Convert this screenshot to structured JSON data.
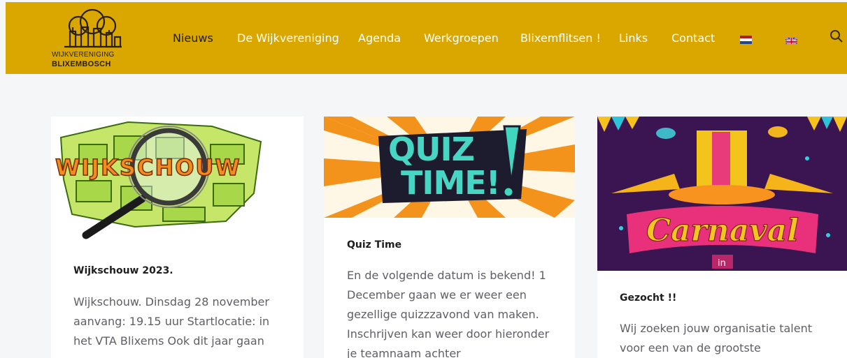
{
  "header": {
    "logo_line1": "WIJKVERENIGING",
    "logo_line2": "BLIXEMBOSCH",
    "bg_color": "#d9a700",
    "nav": [
      {
        "label": "Nieuws",
        "active": true
      },
      {
        "label": "De Wijkvereniging"
      },
      {
        "label": "Agenda"
      },
      {
        "label": "Werkgroepen"
      },
      {
        "label": "Blixemflitsen !"
      },
      {
        "label": "Links"
      },
      {
        "label": "Contact"
      }
    ],
    "flags": [
      "flag-nl-icon",
      "flag-uk-icon"
    ],
    "search_icon": "search-icon"
  },
  "cards": [
    {
      "image_text": "WIJKSCHOUW",
      "title": "Wijkschouw 2023.",
      "lines": [
        "Wijkschouw.  Dinsdag 28 november",
        "  aanvang: 19.15 uur Startlocatie: in",
        "het VTA Blixems Ook dit jaar gaan"
      ]
    },
    {
      "image_text": [
        "QUIZ",
        "TIME!"
      ],
      "title": "Quiz Time",
      "lines": [
        "En de volgende datum is bekend! 1",
        "December gaan we er weer een",
        "gezellige quizzzavond van maken.",
        "Inschrijven kan weer door hieronder",
        "je teamnaam achter"
      ]
    },
    {
      "image_text": [
        "Carnaval",
        "in"
      ],
      "title": "Gezocht !!",
      "lines": [
        "Wij zoeken jouw organisatie talent",
        "voor een van de grootste"
      ]
    }
  ]
}
